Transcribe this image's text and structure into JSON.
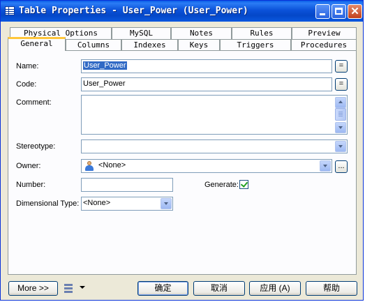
{
  "window": {
    "title": "Table Properties - User_Power (User_Power)"
  },
  "tabs_back": [
    "Physical Options",
    "MySQL",
    "Notes",
    "Rules",
    "Preview"
  ],
  "tabs_front": [
    "General",
    "Columns",
    "Indexes",
    "Keys",
    "Triggers",
    "Procedures"
  ],
  "form": {
    "name_label": "Name:",
    "name_value": "User_Power",
    "code_label": "Code:",
    "code_value": "User_Power",
    "comment_label": "Comment:",
    "comment_value": "",
    "stereotype_label": "Stereotype:",
    "stereotype_value": "",
    "owner_label": "Owner:",
    "owner_value": "<None>",
    "number_label": "Number:",
    "number_value": "",
    "generate_label": "Generate:",
    "generate_checked": true,
    "dimensional_label": "Dimensional Type:",
    "dimensional_value": "<None>",
    "equals_symbol": "=",
    "ellipsis_symbol": "..."
  },
  "footer": {
    "more_label": "More >>",
    "ok_label": "确定",
    "cancel_label": "取消",
    "apply_label": "应用 (A)",
    "help_label": "帮助"
  }
}
